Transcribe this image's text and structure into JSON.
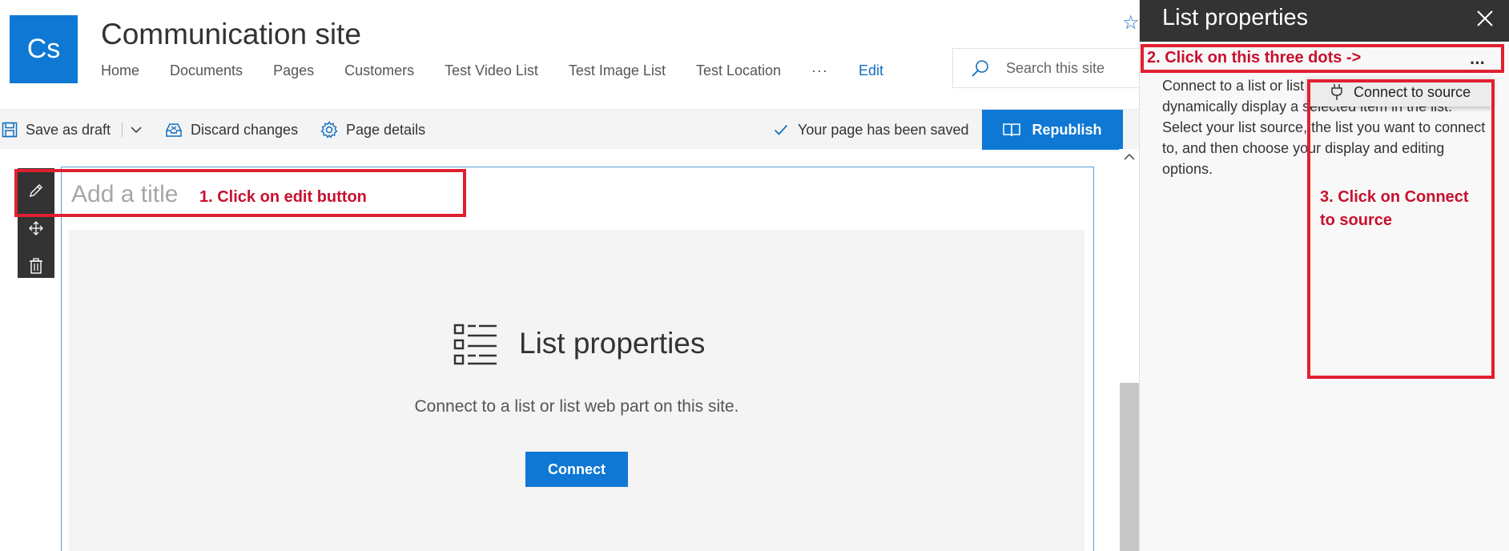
{
  "site": {
    "logo_text": "Cs",
    "title": "Communication site",
    "nav": [
      "Home",
      "Documents",
      "Pages",
      "Customers",
      "Test Video List",
      "Test Image List",
      "Test Location"
    ],
    "nav_more": "···",
    "nav_edit": "Edit",
    "search_placeholder": "Search this site"
  },
  "commandbar": {
    "save_draft": "Save as draft",
    "discard": "Discard changes",
    "page_details": "Page details",
    "saved_status": "Your page has been saved",
    "republish": "Republish"
  },
  "webpart": {
    "title_placeholder": "Add a title",
    "name": "List properties",
    "description": "Connect to a list or list web part on this site.",
    "connect": "Connect"
  },
  "pane": {
    "title": "List properties",
    "more": "···",
    "description": "Connect to a list or list web part on this site to dynamically display a selected item in the list. Select your list source, the list you want to connect to, and then choose your display and editing options.",
    "menu_item": "Connect to source"
  },
  "annotations": {
    "step1": "1. Click on edit button",
    "step2": "2. Click on this three dots ->",
    "step3": "3. Click on Connect to source"
  },
  "colors": {
    "accent": "#0f78d4",
    "pane_header": "#333333",
    "annotation": "#e02030"
  }
}
